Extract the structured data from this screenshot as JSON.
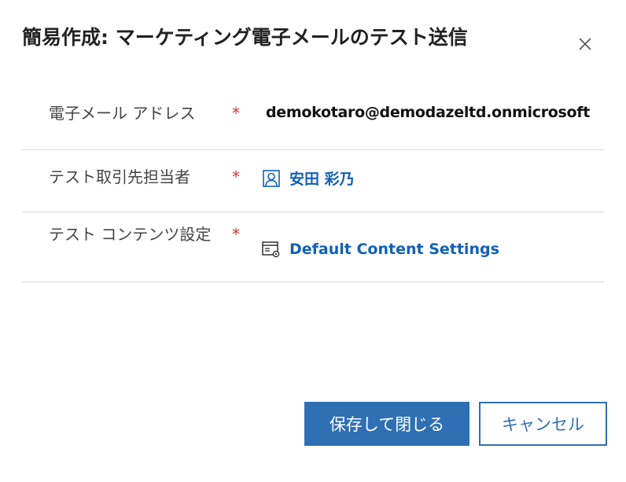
{
  "dialog": {
    "title": "簡易作成: マーケティング電子メールのテスト送信",
    "close_icon": "close-icon"
  },
  "fields": {
    "email": {
      "label": "電子メール アドレス",
      "required_mark": "*",
      "value": "demokotaro@demodazeltd.onmicrosoft"
    },
    "test_contact": {
      "label": "テスト取引先担当者",
      "required_mark": "*",
      "value": "安田 彩乃",
      "icon": "contact-icon"
    },
    "test_content_settings": {
      "label": "テスト コンテンツ設定",
      "required_mark": "*",
      "value": "Default Content Settings",
      "icon": "content-settings-icon"
    }
  },
  "footer": {
    "save_close_label": "保存して閉じる",
    "cancel_label": "キャンセル"
  },
  "colors": {
    "accent": "#2f6fb3",
    "link": "#1160b7",
    "required": "#d13438",
    "divider": "#d8d8d8"
  }
}
